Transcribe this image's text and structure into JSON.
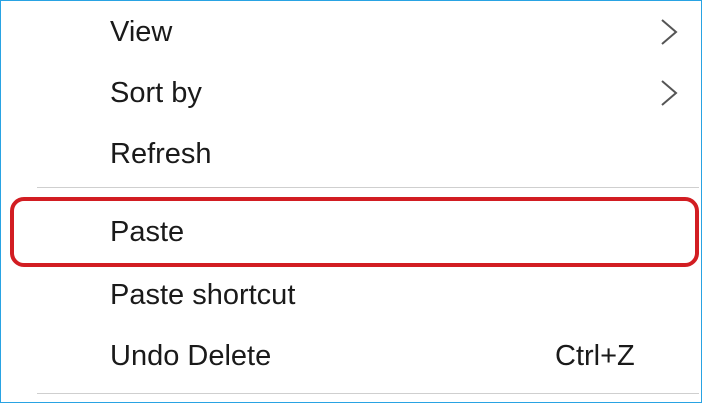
{
  "context_menu": {
    "items": [
      {
        "label": "View",
        "icon": "chevron-right-icon"
      },
      {
        "label": "Sort by",
        "icon": "chevron-right-icon"
      },
      {
        "label": "Refresh"
      },
      {
        "label": "Paste"
      },
      {
        "label": "Paste shortcut"
      },
      {
        "label": "Undo Delete",
        "shortcut": "Ctrl+Z"
      }
    ]
  },
  "colors": {
    "menu_border": "#29a3e3",
    "highlight_border": "#d21d22",
    "text": "#1a1a1a",
    "separator": "#cfcfcf"
  }
}
